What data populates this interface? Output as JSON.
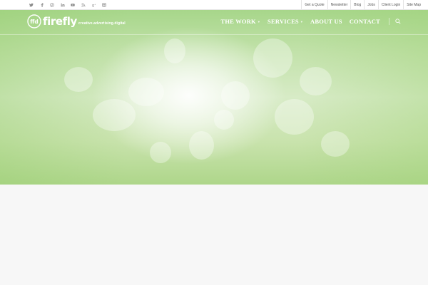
{
  "social": {
    "items": [
      {
        "name": "twitter",
        "glyph": "t"
      },
      {
        "name": "facebook",
        "glyph": "f"
      },
      {
        "name": "pinterest",
        "glyph": "p"
      },
      {
        "name": "linkedin",
        "glyph": "in"
      },
      {
        "name": "youtube",
        "glyph": "yt"
      },
      {
        "name": "rss",
        "glyph": "rss"
      },
      {
        "name": "google-plus",
        "glyph": "g+"
      },
      {
        "name": "instagram",
        "glyph": "ig"
      }
    ]
  },
  "utility_links": [
    "Get a Quote",
    "Newsletter",
    "Blog",
    "Jobs",
    "Client Login",
    "Site Map"
  ],
  "logo": {
    "mark": "ffd",
    "word": "firefly",
    "tagline": "creative.advertising.digital"
  },
  "nav": {
    "items": [
      {
        "label": "THE WORK",
        "has_dropdown": true
      },
      {
        "label": "SERVICES",
        "has_dropdown": true
      },
      {
        "label": "ABOUT US",
        "has_dropdown": false
      },
      {
        "label": "CONTACT",
        "has_dropdown": false
      }
    ]
  },
  "colors": {
    "hero_green": "#b5dc9a",
    "page_bg": "#f7f7f7",
    "topbar_bg": "#ffffff",
    "nav_text": "#ffffff"
  }
}
